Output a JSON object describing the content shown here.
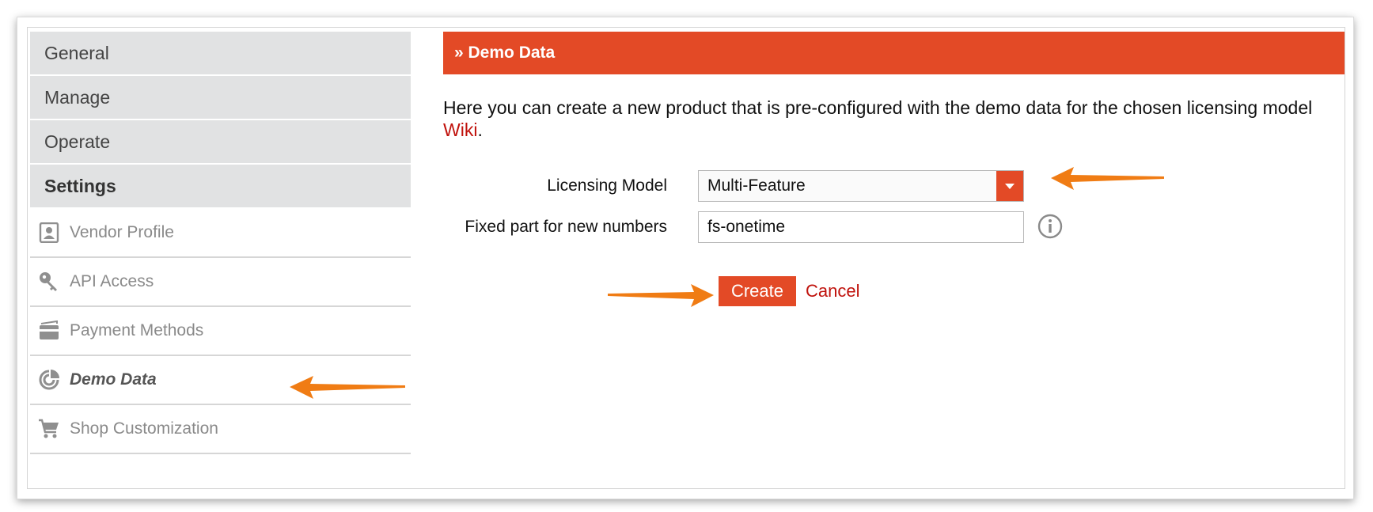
{
  "sidebar": {
    "sections": [
      {
        "label": "General"
      },
      {
        "label": "Manage"
      },
      {
        "label": "Operate"
      },
      {
        "label": "Settings"
      }
    ],
    "items": [
      {
        "label": "Vendor Profile",
        "icon": "vendor-profile-icon"
      },
      {
        "label": "API Access",
        "icon": "key-icon"
      },
      {
        "label": "Payment Methods",
        "icon": "credit-card-icon"
      },
      {
        "label": "Demo Data",
        "icon": "demo-data-icon"
      },
      {
        "label": "Shop Customization",
        "icon": "shopping-cart-icon"
      }
    ]
  },
  "content": {
    "header": "» Demo Data",
    "intro_text": "Here you can create a new product that is pre-configured with the demo data for the chosen licensing model",
    "wiki_link": "Wiki",
    "intro_suffix": "."
  },
  "form": {
    "licensing_model_label": "Licensing Model",
    "licensing_model_value": "Multi-Feature",
    "fixed_part_label": "Fixed part for new numbers",
    "fixed_part_value": "fs-onetime",
    "create_label": "Create",
    "cancel_label": "Cancel"
  },
  "colors": {
    "accent": "#e34a26",
    "link": "#c0120c",
    "menu_background": "#e1e2e3",
    "annotation_arrow": "#f07c14"
  }
}
